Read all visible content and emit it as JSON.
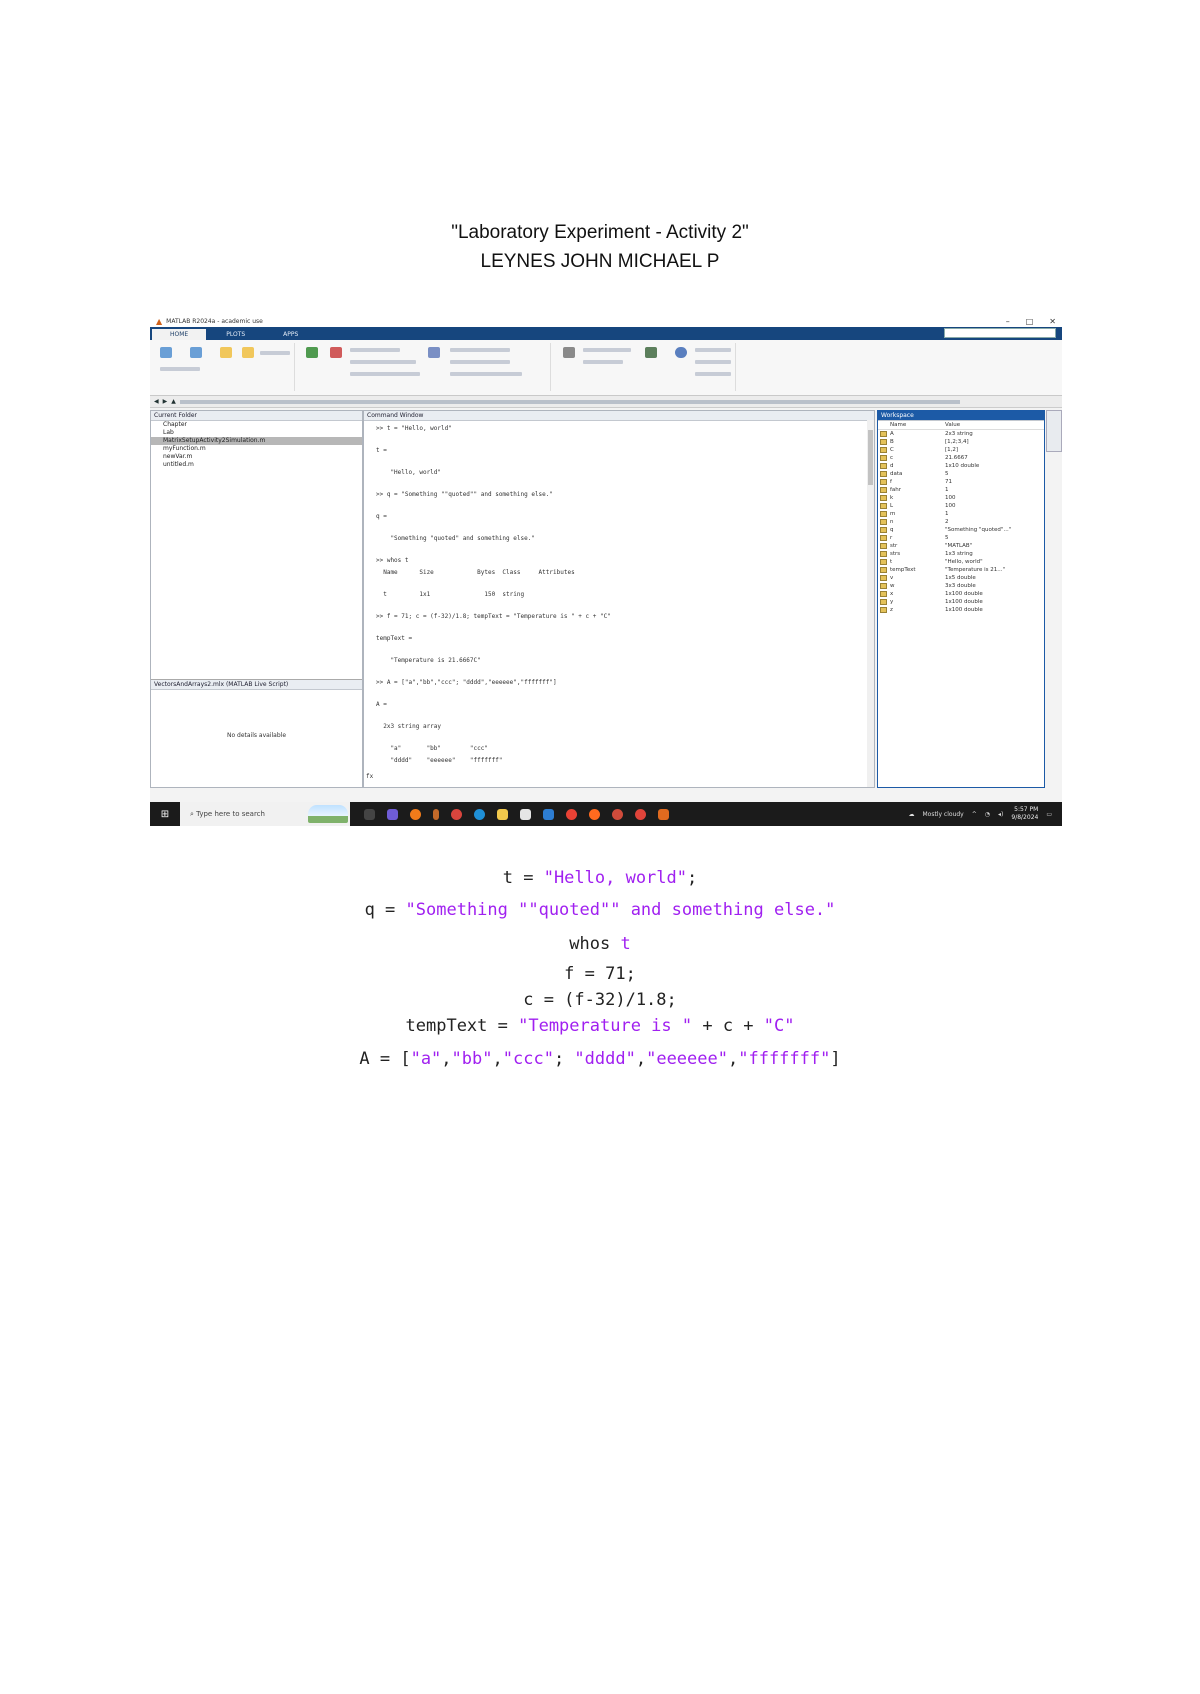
{
  "document": {
    "title": "\"Laboratory Experiment - Activity 2\"",
    "author": "LEYNES JOHN MICHAEL P"
  },
  "screenshot": {
    "window_title": "MATLAB R2024a - academic use",
    "ribbon_tabs": [
      "HOME",
      "PLOTS",
      "APPS"
    ],
    "colors": {
      "ribbon_tab_bar": "#16467e",
      "string": "#a020f0",
      "taskbar": "#1b1b1b"
    },
    "file_items": [
      "Chapter",
      "Lab",
      "MatrixSetupActivity2Simulation.m",
      "myFunction.m",
      "newVar.m",
      "untitled.m"
    ],
    "details_header": "VectorsAndArrays2.mlx (MATLAB Live Script)",
    "details_empty": "No details available",
    "command_lines": [
      ">> t = \"Hello, world\"",
      "t =",
      "    \"Hello, world\"",
      ">> q = \"Something \"\"quoted\"\" and something else.\"",
      "q =",
      "    \"Something \"quoted\" and something else.\"",
      ">> whos t",
      "  Name      Size            Bytes  Class     Attributes",
      "  t         1x1               150  string",
      ">> f = 71; c = (f-32)/1.8; tempText = \"Temperature is \" + c + \"C\"",
      "tempText =",
      "    \"Temperature is 21.6667C\"",
      ">> A = [\"a\",\"bb\",\"ccc\"; \"dddd\",\"eeeeee\",\"fffffff\"]",
      "A =",
      "  2x3 string array",
      "    \"a\"       \"bb\"        \"ccc\"",
      "    \"dddd\"    \"eeeeee\"    \"fffffff\""
    ],
    "workspace_header": "Workspace",
    "workspace_columns": [
      "Name",
      "Value"
    ],
    "workspace_rows": [
      [
        "A",
        "2x3 string"
      ],
      [
        "B",
        "[1,2;3,4]"
      ],
      [
        "C",
        "[1,2]"
      ],
      [
        "c",
        "21.6667"
      ],
      [
        "d",
        "1x10 double"
      ],
      [
        "data",
        "5"
      ],
      [
        "f",
        "71"
      ],
      [
        "fahr",
        "1"
      ],
      [
        "k",
        "100"
      ],
      [
        "L",
        "100"
      ],
      [
        "m",
        "1"
      ],
      [
        "n",
        "2"
      ],
      [
        "q",
        "\"Something \"quoted\"...\""
      ],
      [
        "r",
        "5"
      ],
      [
        "str",
        "\"MATLAB\""
      ],
      [
        "strs",
        "1x3 string"
      ],
      [
        "t",
        "\"Hello, world\""
      ],
      [
        "tempText",
        "\"Temperature is 21...\""
      ],
      [
        "v",
        "1x5 double"
      ],
      [
        "w",
        "3x3 double"
      ],
      [
        "x",
        "1x100 double"
      ],
      [
        "y",
        "1x100 double"
      ],
      [
        "z",
        "1x100 double"
      ]
    ],
    "taskbar_search": "Type here to search",
    "tray_weather": "Mostly cloudy",
    "tray_time": "5:57 PM",
    "tray_date": "9/8/2024"
  },
  "code": {
    "line1": {
      "pre": "t = ",
      "str": "\"Hello, world\"",
      "post": ";"
    },
    "line2": {
      "pre": "q = ",
      "str": "\"Something \"\"quoted\"\" and something else.\""
    },
    "line3": {
      "pre": "whos ",
      "str": "t"
    },
    "line4": "f = 71;",
    "line5": "c = (f-32)/1.8;",
    "line6": {
      "pre": "tempText = ",
      "str1": "\"Temperature is \"",
      "mid": " + c + ",
      "str2": "\"C\""
    },
    "line7": {
      "pre": "A = [",
      "s1": "\"a\"",
      "c1": ",",
      "s2": "\"bb\"",
      "c2": ",",
      "s3": "\"ccc\"",
      "c3": "; ",
      "s4": "\"dddd\"",
      "c4": ",",
      "s5": "\"eeeeee\"",
      "c5": ",",
      "s6": "\"fffffff\"",
      "post": "]"
    }
  }
}
